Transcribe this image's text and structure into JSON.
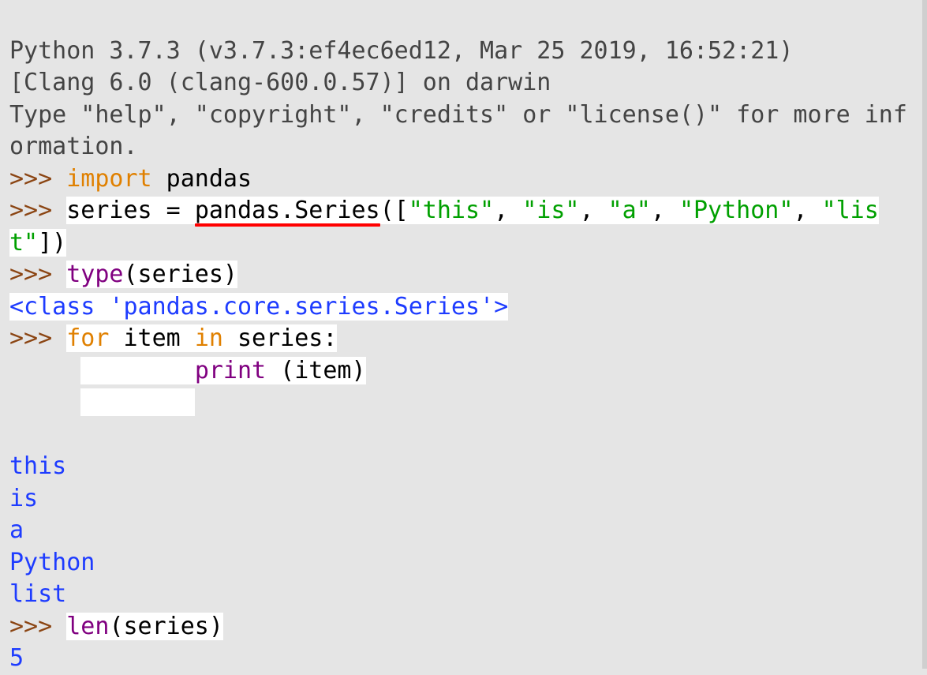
{
  "header": {
    "line1": "Python 3.7.3 (v3.7.3:ef4ec6ed12, Mar 25 2019, 16:52:21) ",
    "line2": "[Clang 6.0 (clang-600.0.57)] on darwin",
    "line3": "Type \"help\", \"copyright\", \"credits\" or \"license()\" for more information."
  },
  "prompt": ">>> ",
  "contPrompt": "     ",
  "line_import": {
    "kw": "import",
    "rest": " pandas"
  },
  "line_series": {
    "var": "series = ",
    "call": "pandas.Series",
    "open": "([",
    "s1": "\"this\"",
    "c1": ", ",
    "s2": "\"is\"",
    "c2": ", ",
    "s3": "\"a\"",
    "c3": ", ",
    "s4": "\"Python\"",
    "c4": ", ",
    "s5": "\"list\"",
    "close": "])"
  },
  "line_type": {
    "fn": "type",
    "args": "(series)"
  },
  "out_type": "<class 'pandas.core.series.Series'>",
  "line_for": {
    "kw_for": "for",
    "sp1": " item ",
    "kw_in": "in",
    "rest": " series:"
  },
  "line_print": {
    "indent": "        ",
    "fn": "print",
    "args": " (item)"
  },
  "line_blank_indent": "        ",
  "out_loop": {
    "l1": "this",
    "l2": "is",
    "l3": "a",
    "l4": "Python",
    "l5": "list"
  },
  "line_len": {
    "fn": "len",
    "args": "(series)"
  },
  "out_len": "5"
}
